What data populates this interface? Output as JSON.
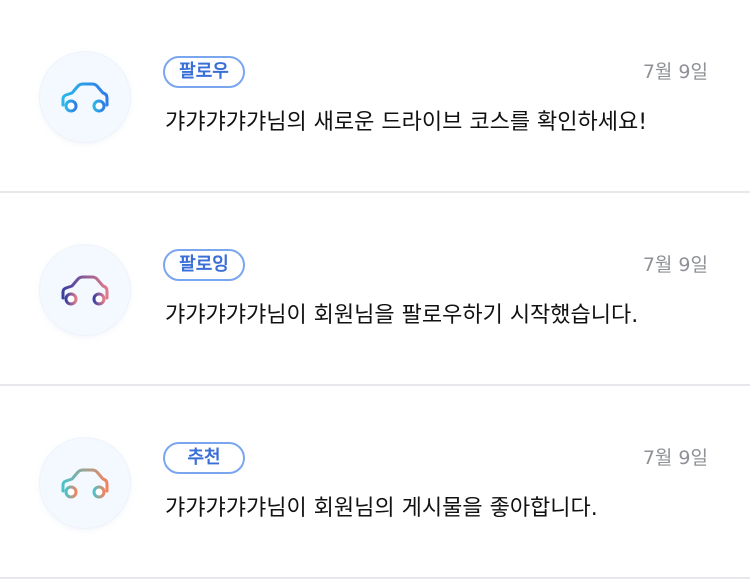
{
  "notifications": [
    {
      "badge": "팔로우",
      "date": "7월 9일",
      "message": "갸갸갸갸갸님의 새로운 드라이브 코스를 확인하세요!",
      "icon": "car-icon",
      "icon_colors": [
        "#2bb6e8",
        "#2f7be8"
      ]
    },
    {
      "badge": "팔로잉",
      "date": "7월 9일",
      "message": "갸갸갸갸갸님이 회원님을 팔로우하기 시작했습니다.",
      "icon": "car-icon",
      "icon_colors": [
        "#3a3fa0",
        "#e07a8a"
      ]
    },
    {
      "badge": "추천",
      "date": "7월 9일",
      "message": "갸갸갸갸갸님이 회원님의 게시물을 좋아합니다.",
      "icon": "car-icon",
      "icon_colors": [
        "#49c2c8",
        "#f0845f"
      ]
    }
  ]
}
